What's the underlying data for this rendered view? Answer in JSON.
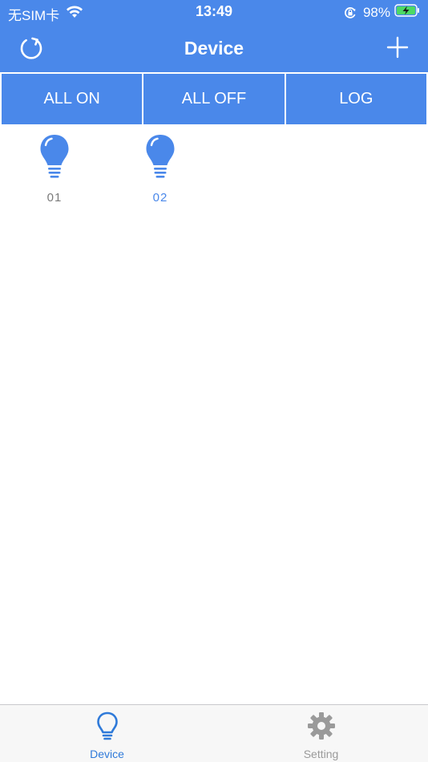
{
  "colors": {
    "primary": "#4a88ea",
    "device_off_label": "#7a7a7a",
    "device_on_label": "#4a88ea",
    "tab_active": "#2f7ad9",
    "tab_inactive": "#9a9a9a"
  },
  "status_bar": {
    "carrier": "无SIM卡",
    "time": "13:49",
    "battery_percent": "98%",
    "icons": [
      "wifi-icon",
      "orientation-lock-icon",
      "battery-charging-icon"
    ]
  },
  "nav": {
    "title": "Device",
    "left_icon": "refresh-icon",
    "right_icon": "plus-icon"
  },
  "actions": [
    {
      "label": "ALL ON"
    },
    {
      "label": "ALL OFF"
    },
    {
      "label": "LOG"
    }
  ],
  "devices": [
    {
      "label": "01",
      "icon": "lightbulb-icon"
    },
    {
      "label": "02",
      "icon": "lightbulb-icon"
    }
  ],
  "tabs": [
    {
      "label": "Device",
      "icon": "lightbulb-outline-icon",
      "active": true
    },
    {
      "label": "Setting",
      "icon": "gear-icon",
      "active": false
    }
  ]
}
